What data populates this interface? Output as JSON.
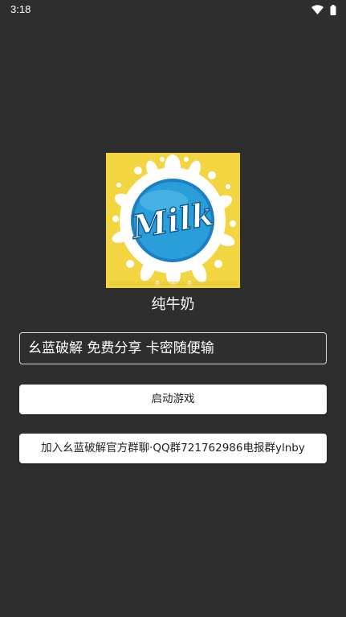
{
  "status_bar": {
    "time": "3:18",
    "icons": [
      "wifi-icon",
      "battery-icon"
    ]
  },
  "logo": {
    "text": "Milk",
    "background_color": "#f2d541",
    "circle_color": "#2a9ed8"
  },
  "app": {
    "name": "纯牛奶"
  },
  "input": {
    "value": "幺蓝破解 免费分享 卡密随便输"
  },
  "buttons": {
    "start_label": "启动游戏",
    "join_label": "加入幺蓝破解官方群聊·QQ群721762986电报群ylnby"
  },
  "colors": {
    "background": "#2e2e2e",
    "button": "#ffffff",
    "text": "#ffffff"
  }
}
